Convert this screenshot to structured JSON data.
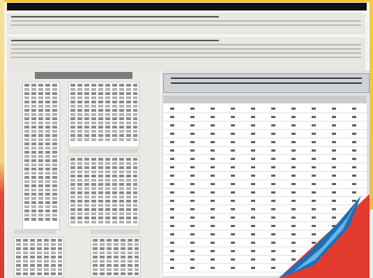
{
  "colors": {
    "title_bar": "#121212",
    "accent_yellow": "#f3c81e",
    "corner_red": "#e23a2f",
    "corner_blue": "#1d6fb8",
    "table_header": "#c9cbcd"
  },
  "document": {
    "title": "",
    "left_panel_title": "",
    "callout_text": ""
  }
}
